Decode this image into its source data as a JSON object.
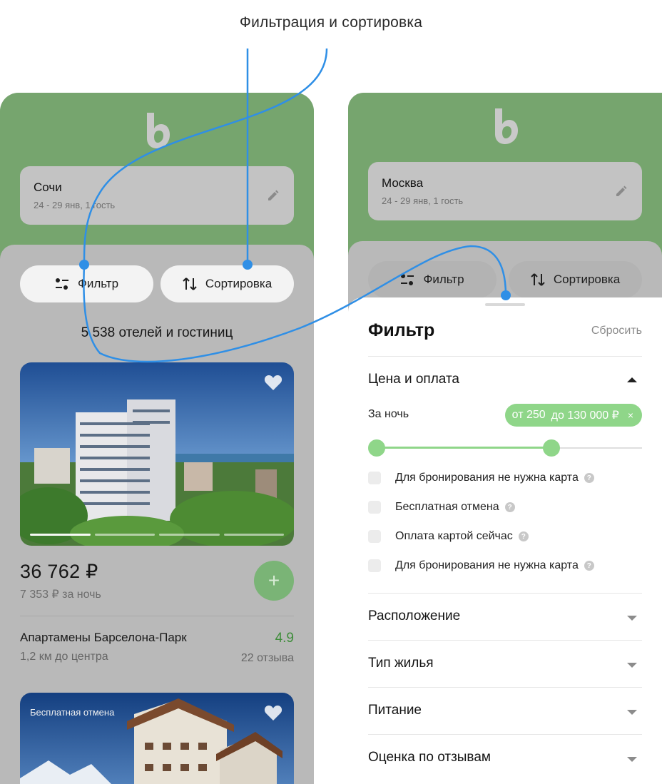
{
  "caption": "Фильтрация и сортировка",
  "colors": {
    "brand_green": "#76a56e",
    "accent_green": "#8fd689",
    "connector_blue": "#2f8fe6"
  },
  "left": {
    "search": {
      "city": "Сочи",
      "dates": "24 - 29 янв, 1 гость"
    },
    "filter_label": "Фильтр",
    "sort_label": "Сортировка",
    "count": "5 538 отелей и гостиниц",
    "card1": {
      "price": "36 762 ₽",
      "per_night": "7 353 ₽ за ночь",
      "name": "Апартамены Барселона-Парк",
      "distance": "1,2 км до центра",
      "rating": "4.9",
      "reviews": "22 отзыва",
      "add": "+"
    },
    "card2": {
      "badge": "Бесплатная отмена"
    }
  },
  "right": {
    "search": {
      "city": "Москва",
      "dates": "24 - 29 янв, 1 гость"
    },
    "filter_label": "Фильтр",
    "sort_label": "Сортировка",
    "sheet": {
      "title": "Фильтр",
      "reset": "Сбросить",
      "price_section": "Цена и оплата",
      "per_night": "За ночь",
      "range_from": "от 250",
      "range_to": "до 130 000 ₽",
      "clear": "×",
      "options": [
        "Для бронирования не нужна карта",
        "Бесплатная отмена",
        "Оплата картой сейчас",
        "Для бронирования не нужна карта"
      ],
      "help": "?",
      "sections": [
        "Расположение",
        "Тип жилья",
        "Питание",
        "Оценка по отзывам"
      ]
    }
  }
}
